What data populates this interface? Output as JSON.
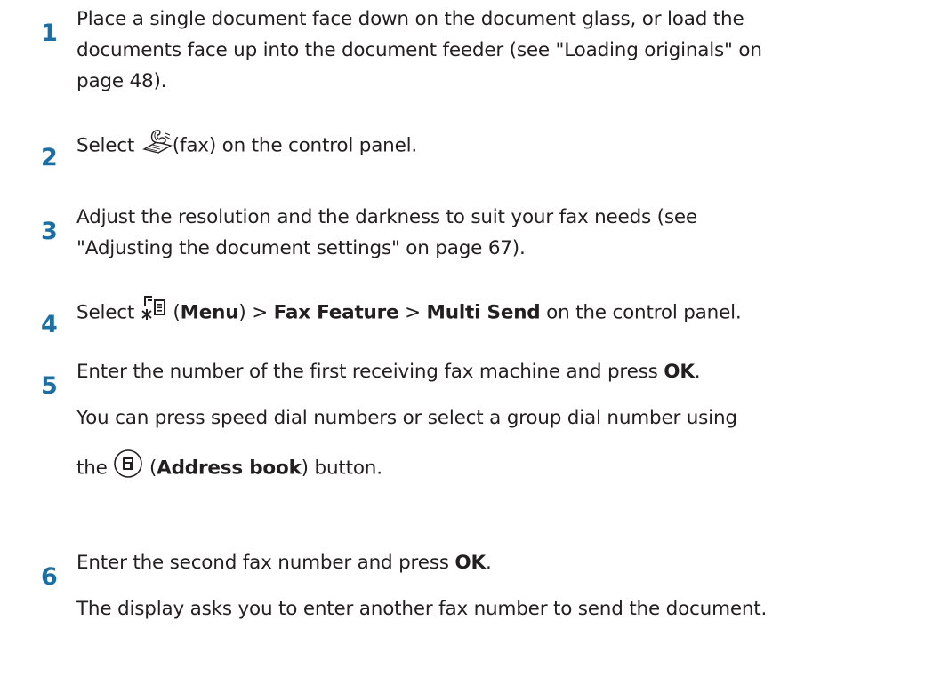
{
  "steps": [
    {
      "number": "1",
      "lines": [
        "Place a single document face down on the document glass, or load the",
        "documents face up into the document feeder (see \"Loading originals\" on",
        "page 48)."
      ]
    },
    {
      "number": "2",
      "before": "Select ",
      "icon_label": "(fax)",
      "after": " on the control panel.",
      "icon": "fax-icon"
    },
    {
      "number": "3",
      "lines": [
        "Adjust the resolution and the darkness to suit your fax needs (see",
        "\"Adjusting the document settings\" on page 67)."
      ]
    },
    {
      "number": "4",
      "before": "Select ",
      "open_paren": " (",
      "menu": "Menu",
      "sep1": ") > ",
      "feature": "Fax Feature",
      "sep2": " > ",
      "multi_send": "Multi Send",
      "after": " on the control panel.",
      "icon": "menu-icon"
    },
    {
      "number": "5",
      "line1_text": "Enter the number of the first receiving fax machine and press ",
      "line1_bold": "OK",
      "line1_end": ".",
      "line2": "You can press speed dial numbers or select a group dial number using",
      "line3_before": "the ",
      "line3_paren_open": " (",
      "line3_bold": "Address book",
      "line3_after": ") button.",
      "icon": "address-book-icon"
    },
    {
      "number": "6",
      "line1_text": "Enter the second fax number and press ",
      "line1_bold": "OK",
      "line1_end": ".",
      "line2": "The display asks you to enter another fax number to send the document."
    }
  ],
  "colors": {
    "step_number": "#1d6fa3",
    "text": "#231f20"
  }
}
